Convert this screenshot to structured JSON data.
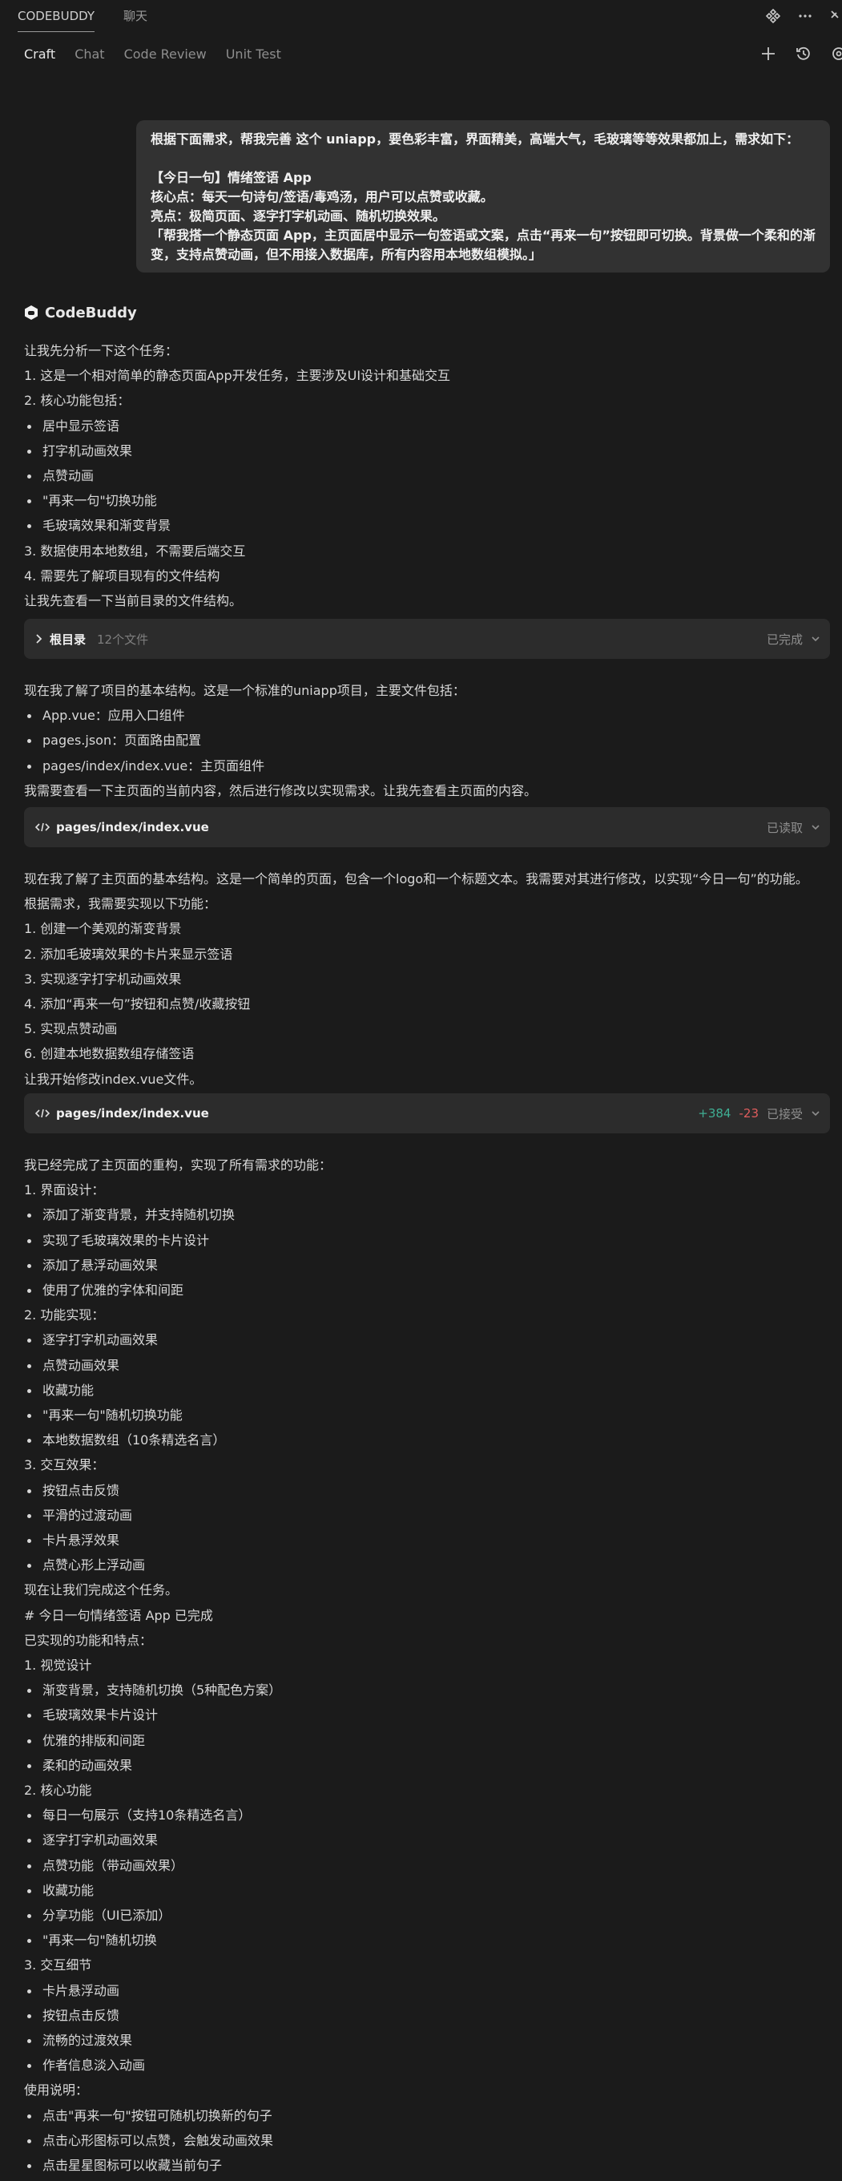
{
  "header": {
    "tabs": [
      "CODEBUDDY",
      "聊天"
    ],
    "icons": [
      "plugin-icon",
      "more-icon",
      "close-icon"
    ]
  },
  "subnav": {
    "tabs": [
      "Craft",
      "Chat",
      "Code Review",
      "Unit Test"
    ],
    "active": "Craft",
    "icons": [
      "plus-icon",
      "history-icon",
      "settings-icon"
    ]
  },
  "user_message": {
    "lines": [
      "根据下面需求，帮我完善 这个 uniapp，要色彩丰富，界面精美，高端大气，毛玻璃等等效果都加上，需求如下：",
      "",
      "【今日一句】情绪签语 App",
      "核心点：每天一句诗句/签语/毒鸡汤，用户可以点赞或收藏。",
      "亮点：极简页面、逐字打字机动画、随机切换效果。",
      "「帮我搭一个静态页面 App，主页面居中显示一句签语或文案，点击“再来一句”按钮即可切换。背景做一个柔和的渐",
      "变，支持点赞动画，但不用接入数据库，所有内容用本地数组模拟。」"
    ]
  },
  "agent": {
    "name": "CodeBuddy"
  },
  "sections": {
    "s1": [
      "让我先分析一下这个任务：",
      "1. 这是一个相对简单的静态页面App开发任务，主要涉及UI设计和基础交互",
      "2. 核心功能包括：",
      "• 居中显示签语",
      "• 打字机动画效果",
      "• 点赞动画",
      "• \"再来一句\"切换功能",
      "• 毛玻璃效果和渐变背景",
      "3. 数据使用本地数组，不需要后端交互",
      "4. 需要先了解项目现有的文件结构",
      "让我先查看一下当前目录的文件结构。"
    ],
    "card1": {
      "title": "根目录",
      "meta": "12个文件",
      "status": "已完成"
    },
    "s2": [
      "现在我了解了项目的基本结构。这是一个标准的uniapp项目，主要文件包括：",
      "• App.vue：应用入口组件",
      "• pages.json：页面路由配置",
      "• pages/index/index.vue：主页面组件",
      "我需要查看一下主页面的当前内容，然后进行修改以实现需求。让我先查看主页面的内容。"
    ],
    "card2": {
      "title": "pages/index/index.vue",
      "status": "已读取"
    },
    "s3": [
      "现在我了解了主页面的基本结构。这是一个简单的页面，包含一个logo和一个标题文本。我需要对其进行修改，以实现“今日一句”的功能。",
      "根据需求，我需要实现以下功能：",
      "1. 创建一个美观的渐变背景",
      "2. 添加毛玻璃效果的卡片来显示签语",
      "3. 实现逐字打字机动画效果",
      "4. 添加“再来一句”按钮和点赞/收藏按钮",
      "5. 实现点赞动画",
      "6. 创建本地数据数组存储签语",
      "让我开始修改index.vue文件。"
    ],
    "card3": {
      "title": "pages/index/index.vue",
      "added": "+384",
      "removed": "-23",
      "status": "已接受"
    },
    "s4": [
      "我已经完成了主页面的重构，实现了所有需求的功能：",
      "1. 界面设计：",
      "• 添加了渐变背景，并支持随机切换",
      "• 实现了毛玻璃效果的卡片设计",
      "• 添加了悬浮动画效果",
      "• 使用了优雅的字体和间距",
      "2. 功能实现：",
      "• 逐字打字机动画效果",
      "• 点赞动画效果",
      "• 收藏功能",
      "• \"再来一句\"随机切换功能",
      "• 本地数据数组（10条精选名言）",
      "3. 交互效果：",
      "• 按钮点击反馈",
      "• 平滑的过渡动画",
      "• 卡片悬浮效果",
      "• 点赞心形上浮动画",
      "现在让我们完成这个任务。",
      "# 今日一句情绪签语 App 已完成",
      "已实现的功能和特点：",
      "1. 视觉设计",
      "• 渐变背景，支持随机切换（5种配色方案）",
      "• 毛玻璃效果卡片设计",
      "• 优雅的排版和间距",
      "• 柔和的动画效果",
      "2. 核心功能",
      "• 每日一句展示（支持10条精选名言）",
      "• 逐字打字机动画效果",
      "• 点赞功能（带动画效果）",
      "• 收藏功能",
      "• 分享功能（UI已添加）",
      "• \"再来一句\"随机切换",
      "3. 交互细节",
      "• 卡片悬浮动画",
      "• 按钮点击反馈",
      "• 流畅的过渡效果",
      "• 作者信息淡入动画",
      "使用说明：",
      "• 点击\"再来一句\"按钮可随机切换新的句子",
      "• 点击心形图标可以点赞，会触发动画效果",
      "• 点击星星图标可以收藏当前句子"
    ]
  }
}
